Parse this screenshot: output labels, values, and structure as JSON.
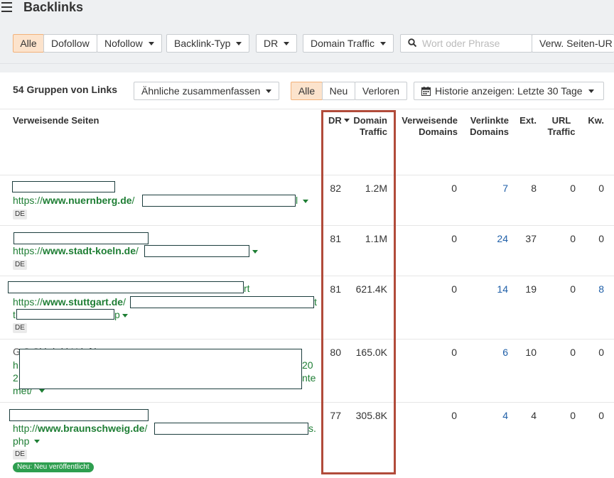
{
  "header": {
    "title": "Backlinks"
  },
  "filters": {
    "all": "Alle",
    "dofollow": "Dofollow",
    "nofollow": "Nofollow",
    "backlink_type": "Backlink-Typ",
    "dr": "DR",
    "domain_traffic": "Domain Traffic",
    "search_placeholder": "Wort oder Phrase",
    "ref_page_url": "Verw. Seiten-UR"
  },
  "summary": {
    "groups_label": "54 Gruppen von Links",
    "group_similar": "Ähnliche zusammenfassen",
    "tab_all": "Alle",
    "tab_new": "Neu",
    "tab_lost": "Verloren",
    "history": "Historie anzeigen: Letzte 30 Tage"
  },
  "columns": {
    "ref_pages": "Verweisende Seiten",
    "dr": "DR",
    "domain_traffic_1": "Domain",
    "domain_traffic_2": "Traffic",
    "ref_domains_1": "Verweisende",
    "ref_domains_2": "Domains",
    "linked_domains_1": "Verlinkte",
    "linked_domains_2": "Domains",
    "ext": "Ext.",
    "url_traffic_1": "URL",
    "url_traffic_2": "Traffic",
    "kw": "Kw."
  },
  "rows": [
    {
      "url_prefix": "https://",
      "domain": "www.nuernberg.de",
      "url_tail": "/",
      "country": "DE",
      "dr": "82",
      "domain_traffic": "1.2M",
      "ref_domains": "0",
      "linked_domains": "7",
      "ext": "8",
      "url_traffic": "0",
      "kw": "0"
    },
    {
      "url_prefix": "https://",
      "domain": "www.stadt-koeln.de",
      "url_tail": "/",
      "country": "DE",
      "dr": "81",
      "domain_traffic": "1.1M",
      "ref_domains": "0",
      "linked_domains": "24",
      "ext": "37",
      "url_traffic": "0",
      "kw": "0"
    },
    {
      "url_prefix": "https://",
      "domain": "www.stuttgart.de",
      "url_tail": "/",
      "country": "DE",
      "dr": "81",
      "domain_traffic": "621.4K",
      "ref_domains": "0",
      "linked_domains": "14",
      "ext": "19",
      "url_traffic": "0",
      "kw": "8"
    },
    {
      "url_prefix": "",
      "domain": "",
      "url_tail": "",
      "country": "",
      "dr": "80",
      "domain_traffic": "165.0K",
      "ref_domains": "0",
      "linked_domains": "6",
      "ext": "10",
      "url_traffic": "0",
      "kw": "0"
    },
    {
      "url_prefix": "http://",
      "domain": "www.braunschweig.de",
      "url_tail": "/",
      "country": "DE",
      "new_badge": "Neu: Neu veröffentlicht",
      "dr": "77",
      "domain_traffic": "305.8K",
      "ref_domains": "0",
      "linked_domains": "4",
      "ext": "4",
      "url_traffic": "0",
      "kw": "0"
    }
  ],
  "visible_fragments": {
    "r1_end": "l",
    "r3_title_end": "rt",
    "r3_url_end": "t",
    "r3_line3_start": "t",
    "r3_line3_end": "p",
    "r4_title": "G                   S           Si h  h   i        l  H  k  f    h",
    "r4_line2_start": "h",
    "r4_line2_end": "20",
    "r4_line3_start": "2",
    "r4_line3_end": "nte",
    "r4_line4": "met/",
    "r5_url_end": "s.",
    "r5_line2": "php"
  },
  "colors": {
    "accent_active_bg": "#fce3cc",
    "link_green": "#1e7e34",
    "link_blue": "#1f5fa8",
    "highlight_border": "#b14b3a",
    "new_badge_bg": "#2e9e4f"
  }
}
